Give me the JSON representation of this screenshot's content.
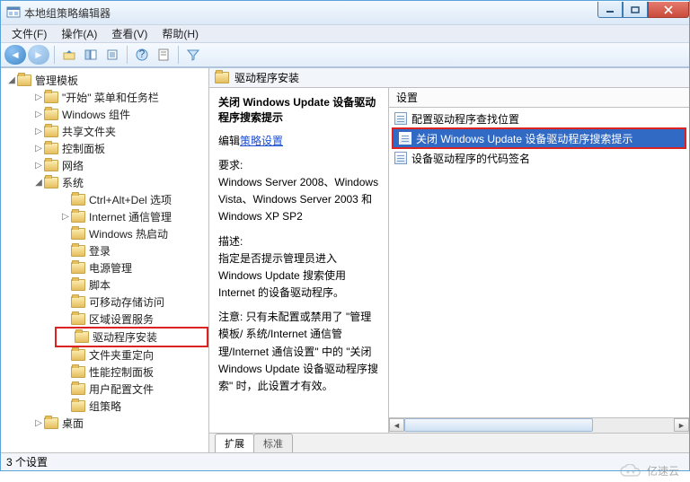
{
  "window": {
    "title": "本地组策略编辑器"
  },
  "menu": {
    "file": "文件(F)",
    "action": "操作(A)",
    "view": "查看(V)",
    "help": "帮助(H)"
  },
  "tree": {
    "root": "管理模板",
    "items": [
      "\"开始\" 菜单和任务栏",
      "Windows 组件",
      "共享文件夹",
      "控制面板",
      "网络",
      "系统"
    ],
    "system_children": [
      "Ctrl+Alt+Del 选项",
      "Internet 通信管理",
      "Windows 热启动",
      "登录",
      "电源管理",
      "脚本",
      "可移动存储访问",
      "区域设置服务",
      "驱动程序安装",
      "文件夹重定向",
      "性能控制面板",
      "用户配置文件",
      "组策略"
    ],
    "after_system": "桌面"
  },
  "header_title": "驱动程序安装",
  "detail": {
    "title": "关闭 Windows Update 设备驱动程序搜索提示",
    "edit_label": "编辑",
    "edit_link": "策略设置",
    "req_label": "要求:",
    "req_body": "Windows Server 2008、Windows Vista、Windows Server 2003 和 Windows XP SP2",
    "desc_label": "描述:",
    "desc_body1": "指定是否提示管理员进入 Windows Update 搜索使用 Internet 的设备驱动程序。",
    "desc_body2": "注意: 只有未配置或禁用了 \"管理模板/ 系统/Internet 通信管理/Internet 通信设置\" 中的 \"关闭 Windows Update 设备驱动程序搜索\" 时，此设置才有效。"
  },
  "list": {
    "col_header": "设置",
    "rows": [
      "配置驱动程序查找位置",
      "关闭 Windows Update 设备驱动程序搜索提示",
      "设备驱动程序的代码签名"
    ]
  },
  "tabs": {
    "extended": "扩展",
    "standard": "标准"
  },
  "status": "3 个设置",
  "watermark": "亿速云"
}
